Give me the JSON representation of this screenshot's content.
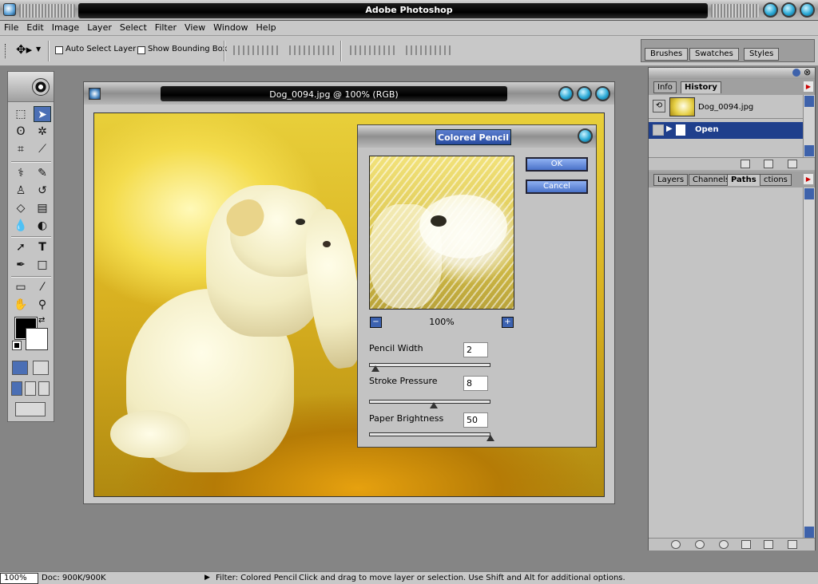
{
  "app": {
    "title": "Adobe Photoshop"
  },
  "menu": [
    "File",
    "Edit",
    "Image",
    "Layer",
    "Select",
    "Filter",
    "View",
    "Window",
    "Help"
  ],
  "options": {
    "auto_select_label": "Auto Select Layer",
    "show_bbox_label": "Show Bounding Box"
  },
  "palette_well": {
    "tabs": [
      "Brushes",
      "Swatches",
      "Styles"
    ]
  },
  "document": {
    "title": "Dog_0094.jpg @ 100% (RGB)"
  },
  "dialog": {
    "title": "Colored Pencil",
    "ok_label": "OK",
    "cancel_label": "Cancel",
    "zoom": "100%",
    "zoom_out_glyph": "−",
    "zoom_in_glyph": "+",
    "params": [
      {
        "label": "Pencil Width",
        "value": "2",
        "fraction": 0.05
      },
      {
        "label": "Stroke Pressure",
        "value": "8",
        "fraction": 0.53
      },
      {
        "label": "Paper Brightness",
        "value": "50",
        "fraction": 1.0
      }
    ]
  },
  "history_palette": {
    "tabs": [
      "Info",
      "History"
    ],
    "snapshot": "Dog_0094.jpg",
    "states": [
      {
        "label": "Open"
      }
    ]
  },
  "layers_palette": {
    "tabs": [
      "Layers",
      "Channels",
      "Paths",
      "ctions"
    ]
  },
  "status": {
    "zoom": "100%",
    "doc": "Doc: 900K/900K",
    "filter": "Filter: Colored Pencil",
    "hint": "Click and drag to move layer or selection.  Use Shift and Alt for additional options."
  }
}
